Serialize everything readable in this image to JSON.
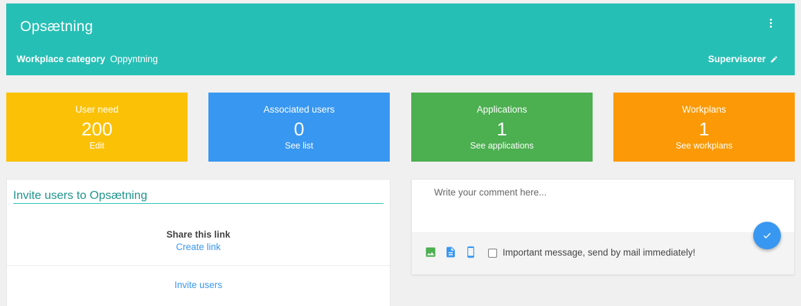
{
  "header": {
    "title": "Opsætning",
    "category_label": "Workplace category",
    "category_value": "Oppyntning",
    "supervisors_label": "Supervisorer",
    "color": "#26bfb5"
  },
  "cards": [
    {
      "label": "User need",
      "value": "200",
      "link": "Edit",
      "color": "#fbc106"
    },
    {
      "label": "Associated users",
      "value": "0",
      "link": "See list",
      "color": "#3897f0"
    },
    {
      "label": "Applications",
      "value": "1",
      "link": "See applications",
      "color": "#4caf50"
    },
    {
      "label": "Workplans",
      "value": "1",
      "link": "See workplans",
      "color": "#fb9a06"
    }
  ],
  "invite": {
    "title": "Invite users to Opsætning",
    "share_label": "Share this link",
    "create_link": "Create link",
    "invite_users": "Invite users"
  },
  "comment": {
    "placeholder": "Write your comment here...",
    "important_label": "Important message, send by mail immediately!",
    "icons": [
      "image-icon",
      "document-icon",
      "mobile-icon"
    ]
  }
}
